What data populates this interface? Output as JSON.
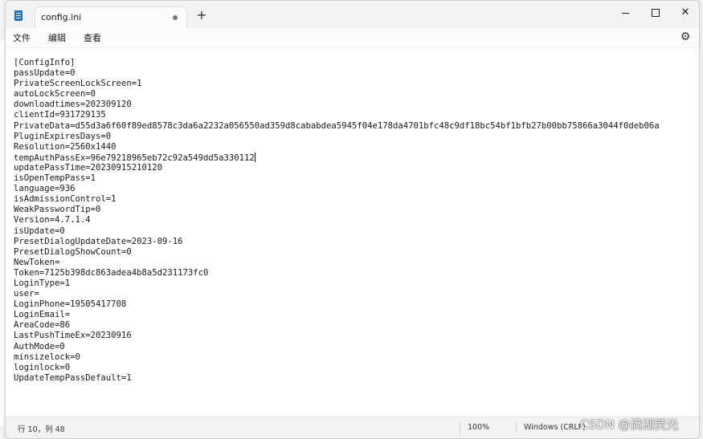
{
  "window": {
    "tab_title": "config.ini",
    "new_tab_label": "+"
  },
  "menu": {
    "file": "文件",
    "edit": "编辑",
    "view": "查看"
  },
  "editor": {
    "lines": [
      "[ConfigInfo]",
      "passUpdate=0",
      "PrivateScreenLockScreen=1",
      "autoLockScreen=0",
      "downloadtimes=202309120",
      "clientId=931729135",
      "PrivateData=d55d3a6f60f89ed8578c3da6a2232a056550ad359d8cababdea5945f04e178da4701bfc48c9df18bc54bf1bfb27b00bb75866a3044f0deb06a",
      "PluginExpiresDays=0",
      "Resolution=2560x1440",
      "tempAuthPassEx=96e79218965eb72c92a549dd5a330112",
      "updatePassTime=20230915210120",
      "isOpenTempPass=1",
      "language=936",
      "isAdmissionControl=1",
      "WeakPasswordTip=0",
      "Version=4.7.1.4",
      "isUpdate=0",
      "PresetDialogUpdateDate=2023-09-16",
      "PresetDialogShowCount=0",
      "NewToken=",
      "Token=7125b398dc863adea4b8a5d231173fc0",
      "LoginType=1",
      "user=",
      "LoginPhone=19505417708",
      "LoginEmail=",
      "AreaCode=86",
      "LastPushTimeEx=20230916",
      "AuthMode=0",
      "minsizelock=0",
      "loginlock=0",
      "UpdateTempPassDefault=1"
    ]
  },
  "status": {
    "position": "行 10，列 48",
    "zoom": "100%",
    "line_ending": "Windows (CRLF)"
  },
  "watermark": "CSDN @满湖荧光",
  "icons": {
    "app": "notepad-icon",
    "settings": "gear-icon",
    "minimize": "minimize-icon",
    "maximize": "maximize-icon",
    "close": "close-icon",
    "unsaved": "unsaved-dot-icon"
  }
}
